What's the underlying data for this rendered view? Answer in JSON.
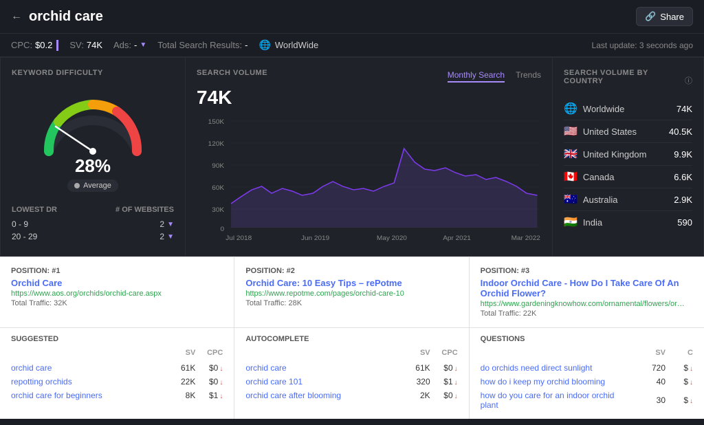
{
  "header": {
    "back_label": "←",
    "title": "orchid care",
    "share_label": "Share",
    "last_update": "Last update: 3 seconds ago"
  },
  "toolbar": {
    "cpc_label": "CPC:",
    "cpc_value": "$0.2",
    "sv_label": "SV:",
    "sv_value": "74K",
    "ads_label": "Ads:",
    "ads_value": "-",
    "total_label": "Total Search Results:",
    "total_value": "-",
    "location": "WorldWide"
  },
  "keyword_difficulty": {
    "title": "KEYWORD DIFFICULTY",
    "value": "28%",
    "badge": "Average",
    "lowest_dr_label": "LOWEST DR",
    "websites_label": "# OF WEBSITES",
    "rows": [
      {
        "range": "0 - 9",
        "count": "2"
      },
      {
        "range": "20 - 29",
        "count": "2"
      }
    ]
  },
  "search_volume": {
    "title": "SEARCH VOLUME",
    "value": "74K",
    "tab_monthly": "Monthly Search",
    "tab_trends": "Trends",
    "chart": {
      "labels": [
        "Jul 2018",
        "Jun 2019",
        "May 2020",
        "Apr 2021",
        "Mar 2022"
      ],
      "y_labels": [
        "150K",
        "120K",
        "90K",
        "60K",
        "30K",
        "0"
      ],
      "data": [
        40,
        45,
        55,
        50,
        60,
        55,
        50,
        48,
        52,
        58,
        55,
        50,
        65,
        62,
        58,
        100,
        85,
        70,
        65,
        68,
        72,
        65,
        60,
        55,
        58,
        60,
        55,
        50,
        48,
        52,
        55,
        50,
        45
      ]
    }
  },
  "countries": {
    "title": "SEARCH VOLUME BY COUNTRY",
    "items": [
      {
        "flag": "🌐",
        "name": "Worldwide",
        "value": "74K"
      },
      {
        "flag": "🇺🇸",
        "name": "United States",
        "value": "40.5K"
      },
      {
        "flag": "🇬🇧",
        "name": "United Kingdom",
        "value": "9.9K"
      },
      {
        "flag": "🇨🇦",
        "name": "Canada",
        "value": "6.6K"
      },
      {
        "flag": "🇦🇺",
        "name": "Australia",
        "value": "2.9K"
      },
      {
        "flag": "🇮🇳",
        "name": "India",
        "value": "590"
      }
    ]
  },
  "positions": [
    {
      "label": "POSITION: #1",
      "link": "Orchid Care",
      "url": "https://www.aos.org/orchids/orchid-care.aspx",
      "traffic": "Total Traffic: 32K"
    },
    {
      "label": "POSITION: #2",
      "link": "Orchid Care: 10 Easy Tips – rePotme",
      "url": "https://www.repotme.com/pages/orchid-care-10",
      "traffic": "Total Traffic: 28K"
    },
    {
      "label": "POSITION: #3",
      "link": "Indoor Orchid Care - How Do I Take Care Of An Orchid Flower?",
      "url": "https://www.gardeningknowhow.com/ornamental/flowers/orchids/indoor-orchid-care.htm",
      "traffic": "Total Traffic: 22K"
    }
  ],
  "suggested": {
    "label": "SUGGESTED",
    "sv_col": "SV",
    "cpc_col": "CPC",
    "items": [
      {
        "name": "orchid care",
        "sv": "61K",
        "cpc": "$0"
      },
      {
        "name": "repotting orchids",
        "sv": "22K",
        "cpc": "$0"
      },
      {
        "name": "orchid care for beginners",
        "sv": "8K",
        "cpc": "$1"
      }
    ]
  },
  "autocomplete": {
    "label": "AUTOCOMPLETE",
    "sv_col": "SV",
    "cpc_col": "CPC",
    "items": [
      {
        "name": "orchid care",
        "sv": "61K",
        "cpc": "$0"
      },
      {
        "name": "orchid care 101",
        "sv": "320",
        "cpc": "$1"
      },
      {
        "name": "orchid care after blooming",
        "sv": "2K",
        "cpc": "$0"
      }
    ]
  },
  "questions": {
    "label": "QUESTIONS",
    "sv_col": "SV",
    "cpc_col": "C",
    "items": [
      {
        "name": "do orchids need direct sunlight",
        "sv": "720",
        "cpc": "$"
      },
      {
        "name": "how do i keep my orchid blooming",
        "sv": "40",
        "cpc": "$"
      },
      {
        "name": "how do you care for an indoor orchid plant",
        "sv": "30",
        "cpc": "$"
      }
    ]
  }
}
